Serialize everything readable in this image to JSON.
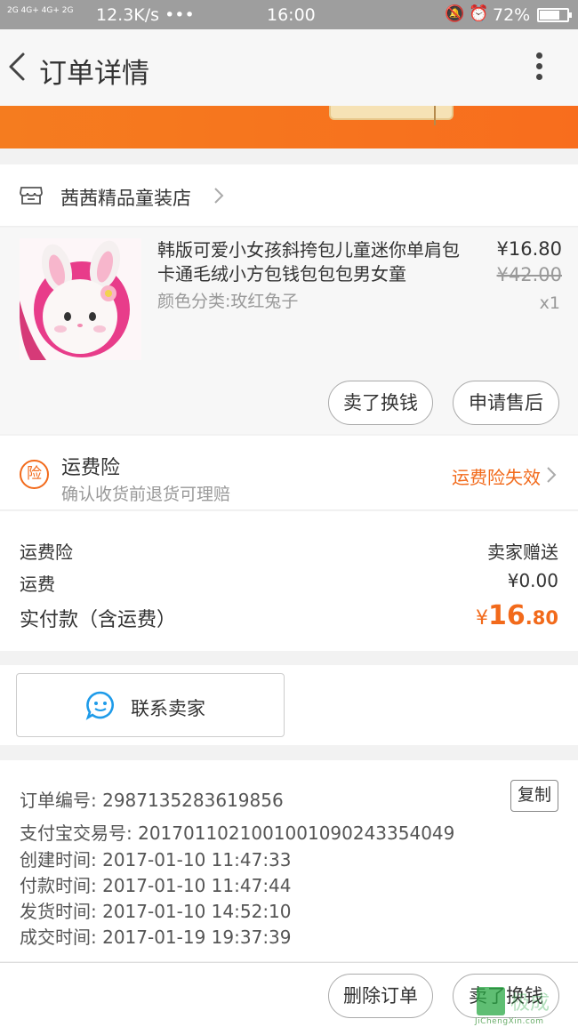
{
  "status_bar": {
    "signal_text": "2G 4G+ 4G+ 2G",
    "speed": "12.3K/s •••",
    "time": "16:00",
    "battery": "72%",
    "battery_level": 0.72
  },
  "header": {
    "title": "订单详情"
  },
  "shop": {
    "name": "茜茜精品童装店"
  },
  "product": {
    "title": "韩版可爱小女孩斜挎包儿童迷你单肩包卡通毛绒小方包钱包包包男女童",
    "variant": "颜色分类:玫红兔子",
    "price": "¥16.80",
    "original_price": "¥42.00",
    "quantity": "x1",
    "sell_button": "卖了换钱",
    "after_sale_button": "申请售后"
  },
  "insurance": {
    "badge": "险",
    "title": "运费险",
    "subtitle": "确认收货前退货可理赔",
    "status": "运费险失效"
  },
  "fees": {
    "insurance_label": "运费险",
    "insurance_value": "卖家赠送",
    "shipping_label": "运费",
    "shipping_value": "¥0.00",
    "paid_label": "实付款（含运费）",
    "paid_currency": "¥",
    "paid_int": "16",
    "paid_dec": ".80"
  },
  "contact": {
    "label": "联系卖家"
  },
  "order_info": {
    "order_no": "订单编号: 2987135283619856",
    "copy": "复制",
    "alipay_no": "支付宝交易号: 2017011021001001090243354049",
    "created": "创建时间: 2017-01-10 11:47:33",
    "paid": "付款时间: 2017-01-10 11:47:44",
    "shipped": "发货时间: 2017-01-10 14:52:10",
    "completed": "成交时间: 2017-01-19 19:37:39"
  },
  "bottom_bar": {
    "delete_button": "删除订单",
    "sell_button": "卖了换钱"
  },
  "watermark": {
    "text": "极成",
    "url": "JiChengXin.com"
  },
  "colors": {
    "accent": "#f26a1b",
    "status_bar": "#9e9e9e"
  }
}
